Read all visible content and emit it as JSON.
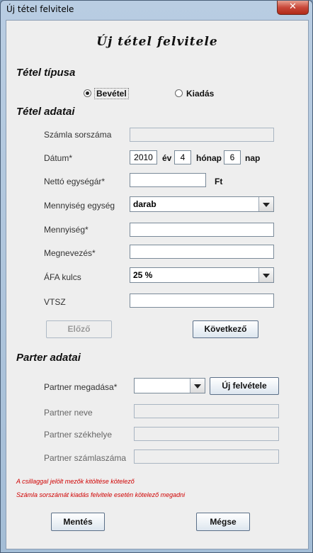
{
  "window": {
    "title": "Új tétel felvitele",
    "close_glyph": "✕"
  },
  "form_title": "Új tétel felvitele",
  "type_section": {
    "heading": "Tétel típusa",
    "options": [
      {
        "label": "Bevétel",
        "selected": true
      },
      {
        "label": "Kiadás",
        "selected": false
      }
    ]
  },
  "item_section": {
    "heading": "Tétel adatai",
    "invoice_number": {
      "label": "Számla sorszáma",
      "value": ""
    },
    "date": {
      "label": "Dátum*",
      "year": "2010",
      "year_unit": "év",
      "month": "4",
      "month_unit": "hónap",
      "day": "6",
      "day_unit": "nap"
    },
    "net_unit_price": {
      "label": "Nettó egységár*",
      "value": "",
      "unit": "Ft"
    },
    "quantity_unit": {
      "label": "Mennyiség egység",
      "value": "darab"
    },
    "quantity": {
      "label": "Mennyiség*",
      "value": ""
    },
    "name": {
      "label": "Megnevezés*",
      "value": ""
    },
    "vat_rate": {
      "label": "ÁFA kulcs",
      "value": "25 %"
    },
    "vtsz": {
      "label": "VTSZ",
      "value": ""
    },
    "prev_button": "Előző",
    "next_button": "Következő"
  },
  "partner_section": {
    "heading": "Parter adatai",
    "partner_select": {
      "label": "Partner megadása*",
      "value": ""
    },
    "new_button": "Új felvétele",
    "partner_name": {
      "label": "Partner neve",
      "value": ""
    },
    "partner_seat": {
      "label": "Partner székhelye",
      "value": ""
    },
    "partner_account": {
      "label": "Partner számlaszáma",
      "value": ""
    }
  },
  "notes": {
    "required": "A csillaggal jelölt mezők kitöltése kötelező",
    "invoice_required": "Számla sorszámát kiadás felvitele esetén kötelező megadni"
  },
  "footer": {
    "save_button": "Mentés",
    "cancel_button": "Mégse"
  },
  "colors": {
    "required_note": "#d00000",
    "window_frame": "#a4bdd6",
    "client_bg": "#eeeeee"
  }
}
